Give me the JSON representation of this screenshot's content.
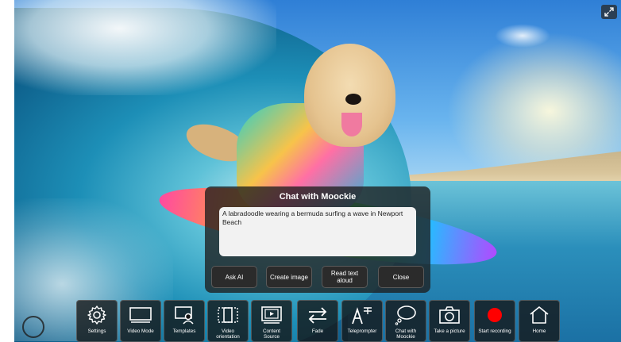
{
  "chat": {
    "title": "Chat with Moockie",
    "prompt_value": "A labradoodle wearing a bermuda surfing a wave in Newport Beach",
    "buttons": {
      "ask_ai": "Ask AI",
      "create_image": "Create image",
      "read_text_aloud_line1": "Read text",
      "read_text_aloud_line2": "aloud",
      "close": "Close"
    }
  },
  "toolbar": [
    {
      "label": "Settings",
      "icon": "gear-icon"
    },
    {
      "label": "Video Mode",
      "icon": "monitor-icon"
    },
    {
      "label": "Templates",
      "icon": "template-user-icon"
    },
    {
      "label1": "Video",
      "label2": "orientation",
      "icon": "orientation-icon"
    },
    {
      "label1": "Content",
      "label2": "Source",
      "icon": "content-source-icon"
    },
    {
      "label": "Fade",
      "icon": "swap-arrows-icon"
    },
    {
      "label": "Teleprompter",
      "icon": "teleprompter-icon"
    },
    {
      "label1": "Chat with",
      "label2": "Moockie",
      "icon": "chat-bubble-icon"
    },
    {
      "label": "Take a picture",
      "icon": "camera-icon"
    },
    {
      "label": "Start recording",
      "icon": "record-dot-icon"
    },
    {
      "label": "Home",
      "icon": "home-icon"
    }
  ],
  "colors": {
    "record": "#ff0000",
    "dialog_bg": "#1e1e1e",
    "toolbar_bg": "#141414"
  }
}
